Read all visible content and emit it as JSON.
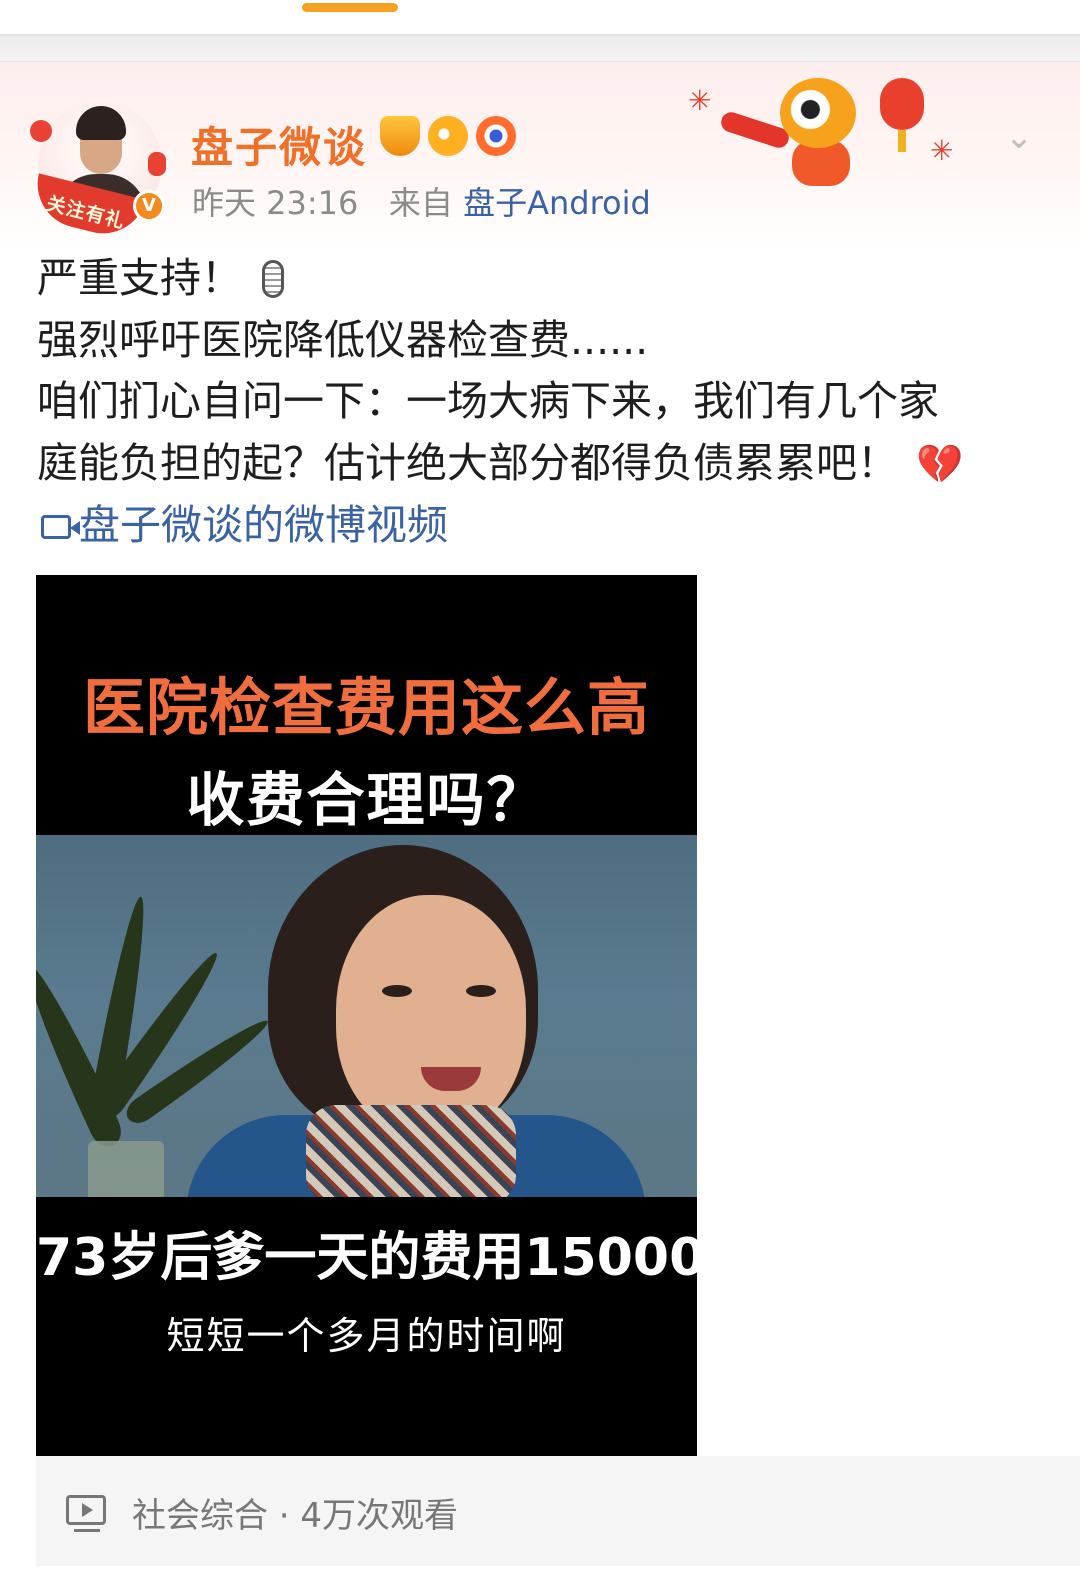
{
  "post": {
    "username": "盘子微谈",
    "time": "昨天 23:16",
    "source_prefix": "来自",
    "source": "盘子Android",
    "avatar_badge_text": "关注有礼",
    "verified_mark": "V",
    "text_lines": [
      "严重支持！",
      "强烈呼吁医院降低仪器检查费......",
      "咱们扪心自问一下：一场大病下来，我们有几个家",
      "庭能负担的起？估计绝大部分都得负债累累吧！"
    ],
    "video_link": "盘子微谈的微博视频"
  },
  "video": {
    "title_top": "医院检查费用这么高",
    "subtitle_top": "收费合理吗？",
    "title_bottom": "73岁后爹一天的费用15000",
    "subtitle_bottom": "短短一个多月的时间啊"
  },
  "footer": {
    "text": "社会综合 · 4万次观看"
  },
  "colors": {
    "accent": "#f6a024",
    "username": "#f0702a",
    "link": "#3b63a3",
    "video_title": "#f06d3e"
  },
  "icons": [
    "tab-indicator",
    "avatar",
    "vip-icon",
    "crown-badge-icon",
    "fish-badge-icon",
    "eye-badge-icon",
    "tiger-decoration-icon",
    "chevron-down-icon",
    "microphone-icon",
    "broken-heart-icon",
    "video-camera-icon",
    "play-icon"
  ]
}
